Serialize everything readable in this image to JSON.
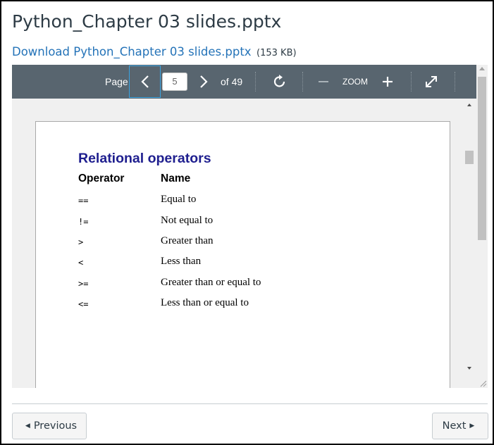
{
  "page": {
    "title": "Python_Chapter 03 slides.pptx",
    "download_link": "Download Python_Chapter 03 slides.pptx",
    "file_size": "(153 KB)"
  },
  "toolbar": {
    "page_label": "Page",
    "current_page": "5",
    "total_label": "of 49",
    "zoom_label": "ZOOM",
    "icons": [
      "chevron-left-icon",
      "chevron-right-icon",
      "rotate-icon",
      "zoom-out-icon",
      "zoom-in-icon",
      "fullscreen-icon"
    ],
    "background_color": "#58656f"
  },
  "slide": {
    "title": "Relational operators",
    "title_color": "#1f1f8f",
    "columns": [
      "Operator",
      "Name"
    ],
    "rows": [
      {
        "operator": "==",
        "name": "Equal to"
      },
      {
        "operator": "!=",
        "name": "Not equal to"
      },
      {
        "operator": ">",
        "name": "Greater than"
      },
      {
        "operator": "<",
        "name": "Less than"
      },
      {
        "operator": ">=",
        "name": "Greater than or equal to"
      },
      {
        "operator": "<=",
        "name": "Less than or equal to"
      }
    ]
  },
  "nav": {
    "previous_label": "Previous",
    "next_label": "Next"
  },
  "colors": {
    "link": "#2473b8",
    "text": "#2d3b45"
  }
}
